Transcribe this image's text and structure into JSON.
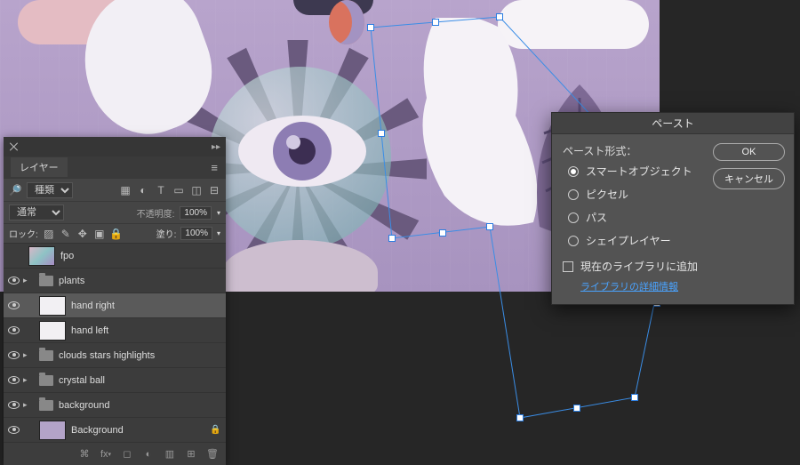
{
  "layers_panel": {
    "tab": "レイヤー",
    "filter_kind": "種類",
    "blend_mode": "通常",
    "opacity_label": "不透明度:",
    "opacity_value": "100%",
    "lock_label": "ロック:",
    "fill_label": "塗り:",
    "fill_value": "100%",
    "search_placeholder": "Q",
    "layers": [
      {
        "name": "fpo",
        "visible": false,
        "kind": "image"
      },
      {
        "name": "plants",
        "visible": true,
        "kind": "folder"
      },
      {
        "name": "hand right",
        "visible": true,
        "kind": "smart",
        "selected": true
      },
      {
        "name": "hand left",
        "visible": true,
        "kind": "smart"
      },
      {
        "name": "clouds stars highlights",
        "visible": true,
        "kind": "folder"
      },
      {
        "name": "crystal ball",
        "visible": true,
        "kind": "folder"
      },
      {
        "name": "background",
        "visible": true,
        "kind": "folder"
      },
      {
        "name": "Background",
        "visible": true,
        "kind": "solid",
        "locked": true
      }
    ]
  },
  "paste_dialog": {
    "title": "ペースト",
    "section_label": "ペースト形式：",
    "options": {
      "smart_object": "スマートオブジェクト",
      "pixels": "ピクセル",
      "path": "パス",
      "shape_layer": "シェイプレイヤー"
    },
    "selected": "smart_object",
    "add_to_library": "現在のライブラリに追加",
    "library_link": "ライブラリの詳細情報",
    "ok": "OK",
    "cancel": "キャンセル"
  }
}
